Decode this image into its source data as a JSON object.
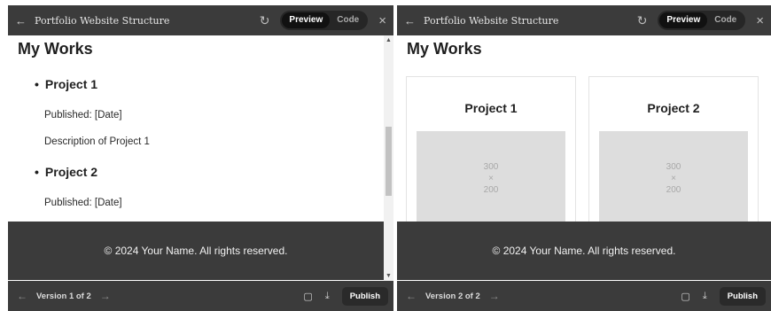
{
  "left": {
    "title": "Portfolio Website Structure",
    "toggle": {
      "preview": "Preview",
      "code": "Code"
    },
    "heading": "My Works",
    "items": [
      {
        "name": "Project 1",
        "published": "Published: [Date]",
        "description": "Description of Project 1"
      },
      {
        "name": "Project 2",
        "published": "Published: [Date]"
      }
    ],
    "footer": "© 2024 Your Name. All rights reserved.",
    "version": "Version 1 of 2",
    "publish": "Publish"
  },
  "right": {
    "title": "Portfolio Website Structure",
    "toggle": {
      "preview": "Preview",
      "code": "Code"
    },
    "heading": "My Works",
    "cards": [
      {
        "title": "Project 1",
        "placeholder": [
          "300",
          "×",
          "200"
        ]
      },
      {
        "title": "Project 2",
        "placeholder": [
          "300",
          "×",
          "200"
        ]
      }
    ],
    "footer": "© 2024 Your Name. All rights reserved.",
    "version": "Version 2 of 2",
    "publish": "Publish"
  },
  "icons": {
    "back": "←",
    "refresh": "↻",
    "close": "×",
    "prev": "←",
    "next": "→",
    "copy": "▢",
    "download": "⤓",
    "scroll_up": "▲",
    "scroll_down": "▼"
  }
}
